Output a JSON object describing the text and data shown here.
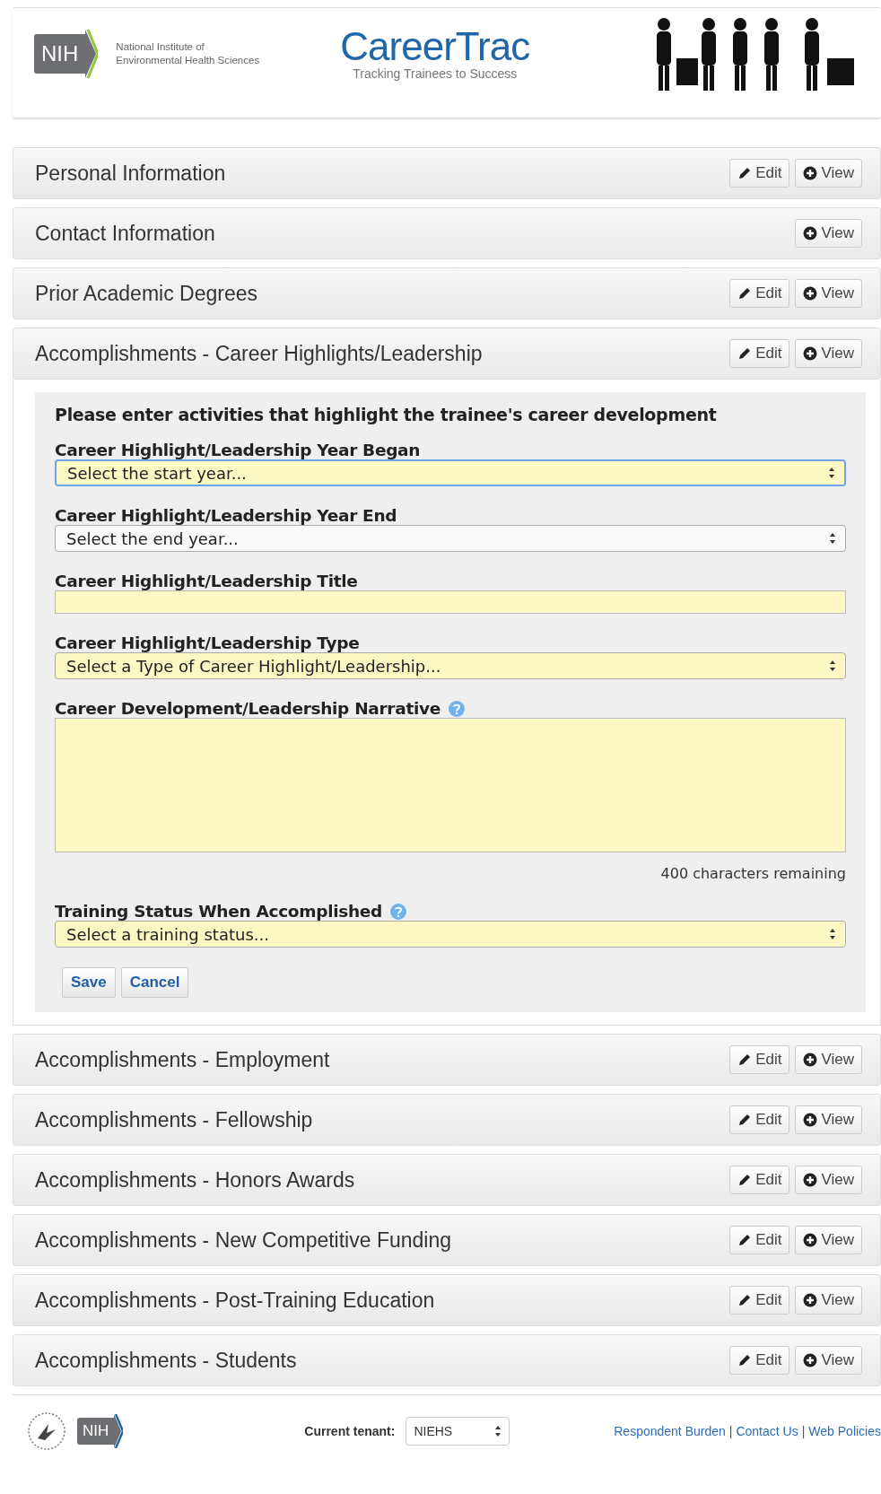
{
  "header": {
    "org_line1": "National Institute of",
    "org_line2": "Environmental Health Sciences",
    "logo_mark": "NIH",
    "app_name": "CareerTrac",
    "tagline": "Tracking Trainees to Success"
  },
  "panels": [
    {
      "title": "Personal Information",
      "edit": true,
      "view": true,
      "expanded": false,
      "edit_label": "Edit",
      "view_label": "View"
    },
    {
      "title": "Contact Information",
      "edit": false,
      "view": true,
      "expanded": false,
      "view_label": "View"
    },
    {
      "title": "Prior Academic Degrees",
      "edit": true,
      "view": true,
      "expanded": false,
      "edit_label": "Edit",
      "view_label": "View"
    },
    {
      "title": "Accomplishments - Career Highlights/Leadership",
      "edit": true,
      "view": true,
      "expanded": true,
      "edit_label": "Edit",
      "view_label": "View"
    },
    {
      "title": "Accomplishments - Employment",
      "edit": true,
      "view": true,
      "expanded": false,
      "edit_label": "Edit",
      "view_label": "View"
    },
    {
      "title": "Accomplishments - Fellowship",
      "edit": true,
      "view": true,
      "expanded": false,
      "edit_label": "Edit",
      "view_label": "View"
    },
    {
      "title": "Accomplishments - Honors Awards",
      "edit": true,
      "view": true,
      "expanded": false,
      "edit_label": "Edit",
      "view_label": "View"
    },
    {
      "title": "Accomplishments - New Competitive Funding",
      "edit": true,
      "view": true,
      "expanded": false,
      "edit_label": "Edit",
      "view_label": "View"
    },
    {
      "title": "Accomplishments - Post-Training Education",
      "edit": true,
      "view": true,
      "expanded": false,
      "edit_label": "Edit",
      "view_label": "View"
    },
    {
      "title": "Accomplishments - Students",
      "edit": true,
      "view": true,
      "expanded": false,
      "edit_label": "Edit",
      "view_label": "View"
    }
  ],
  "form": {
    "intro": "Please enter activities that highlight the trainee's career development",
    "fields": [
      {
        "kind": "select",
        "label": "Career Highlight/Leadership Year Began",
        "value": "Select the start year...",
        "highlighted": true,
        "focused": true,
        "help": false
      },
      {
        "kind": "select",
        "label": "Career Highlight/Leadership Year End",
        "value": "Select the end year...",
        "highlighted": false,
        "focused": false,
        "help": false
      },
      {
        "kind": "text",
        "label": "Career Highlight/Leadership Title",
        "highlighted": true,
        "focused": false,
        "help": false
      },
      {
        "kind": "select",
        "label": "Career Highlight/Leadership Type",
        "value": "Select a Type of Career Highlight/Leadership...",
        "highlighted": true,
        "focused": false,
        "help": false
      },
      {
        "kind": "textarea",
        "label": "Career Development/Leadership Narrative",
        "highlighted": true,
        "focused": false,
        "help": true,
        "counter": "400 characters remaining"
      },
      {
        "kind": "select",
        "label": "Training Status When Accomplished",
        "value": "Select a training status...",
        "highlighted": true,
        "focused": false,
        "help": true
      }
    ],
    "buttons": [
      "Save",
      "Cancel"
    ]
  },
  "footer": {
    "logo_mark": "NIH",
    "tenant_label": "Current tenant:",
    "tenant_value": "NIEHS",
    "links": [
      "Respondent Burden",
      "Contact Us",
      "Web Policies"
    ],
    "link_separator": "|"
  }
}
